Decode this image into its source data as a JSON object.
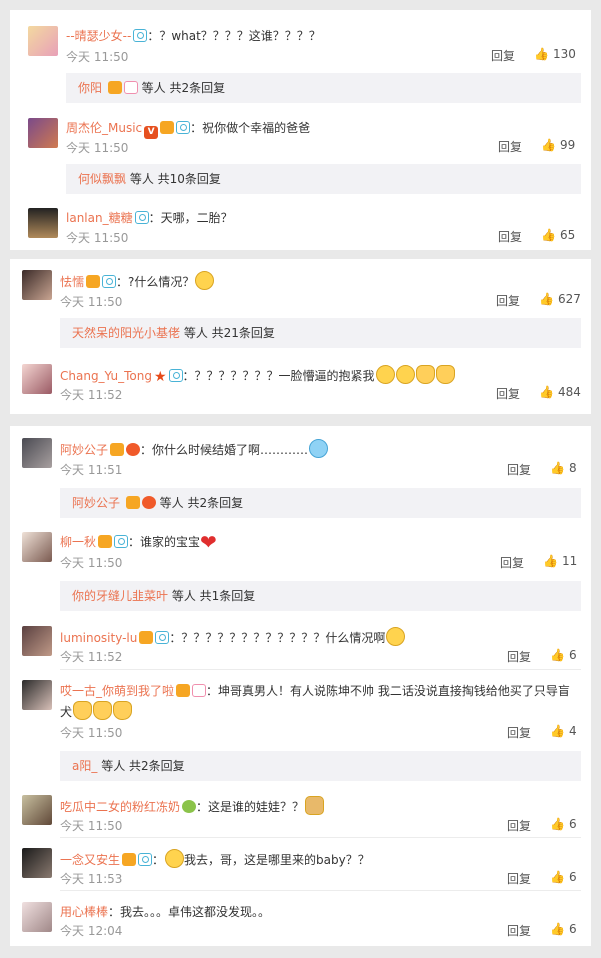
{
  "common": {
    "reply": "回复",
    "replies_suffix_prefix": "等人 "
  },
  "panel1": {
    "comments": [
      {
        "user": "--晴瑟少女--",
        "text": "：？what？？？？这谁？？？？",
        "time": "今天 11:50",
        "likes": "130",
        "sub": {
          "users": "你阳",
          "summary": "等人 共2条回复"
        }
      },
      {
        "user": "周杰伦_Music",
        "text": "：祝你做个幸福的爸爸",
        "time": "今天 11:50",
        "likes": "99",
        "sub": {
          "users": "何似飘飘",
          "summary": "等人 共10条回复"
        }
      },
      {
        "user": "lanlan_糖糖",
        "text": "：天哪，二胎？",
        "time": "今天 11:50",
        "likes": "65"
      }
    ]
  },
  "panel2": {
    "comments": [
      {
        "user": "怯懦",
        "text": "：?什么情况？",
        "time": "今天 11:50",
        "likes": "627",
        "sub": {
          "users": "天然呆的阳光小基佬",
          "summary": "等人 共21条回复"
        }
      },
      {
        "user": "Chang_Yu_Tong",
        "text": "：？？？？？？？一脸懵逼的抱紧我",
        "time": "今天 11:52",
        "likes": "484"
      }
    ]
  },
  "panel3": {
    "comments": [
      {
        "user": "阿妙公子",
        "text": "：你什么时候结婚了啊…………",
        "time": "今天 11:51",
        "likes": "8",
        "sub": {
          "users": "阿妙公子",
          "summary": "等人 共2条回复"
        }
      },
      {
        "user": "柳一秋",
        "text": "：谁家的宝宝",
        "time": "今天 11:50",
        "likes": "11",
        "sub": {
          "users": "你的牙缝儿韭菜叶",
          "summary": "等人 共1条回复"
        }
      },
      {
        "user": "luminosity-lu",
        "text": "：？？？？？？？？？？？？什么情况啊",
        "time": "今天 11:52",
        "likes": "6"
      },
      {
        "user": "哎一古_你萌到我了啦",
        "text": "：坤哥真男人！有人说陈坤不帅 我二话没说直接掏钱给他买了只导盲犬",
        "time": "今天 11:50",
        "likes": "4",
        "sub": {
          "users": "a阳_",
          "summary": "等人 共2条回复"
        }
      },
      {
        "user": "吃瓜中二女的粉红冻奶",
        "text": "：这是谁的娃娃？？",
        "time": "今天 11:50",
        "likes": "6"
      },
      {
        "user": "一念又安生",
        "text": "我去，哥，这是哪里来的baby？？",
        "time": "今天 11:53",
        "likes": "6"
      },
      {
        "user": "用心棒棒",
        "text": "：我去。。。卓伟这都没发现。。",
        "time": "今天 12:04",
        "likes": "6"
      }
    ]
  },
  "colors": {
    "username": "#eb7350",
    "time": "#999999",
    "sub_bg": "#f2f2f5",
    "page_bg": "#e9e9e9"
  }
}
